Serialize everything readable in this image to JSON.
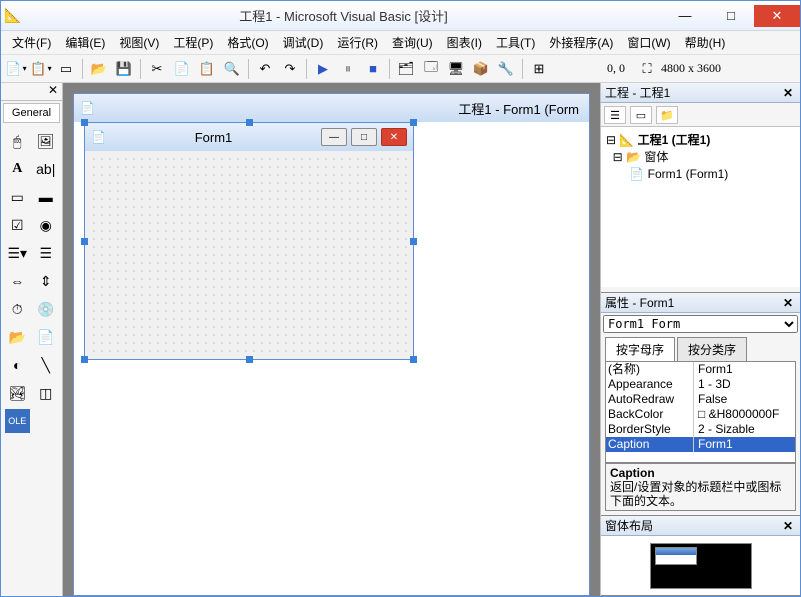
{
  "title": "工程1 - Microsoft Visual Basic [设计]",
  "menu": [
    "文件(F)",
    "编辑(E)",
    "视图(V)",
    "工程(P)",
    "格式(O)",
    "调试(D)",
    "运行(R)",
    "查询(U)",
    "图表(I)",
    "工具(T)",
    "外接程序(A)",
    "窗口(W)",
    "帮助(H)"
  ],
  "coords": "0, 0",
  "dims": "4800 x 3600",
  "toolbox_tab": "General",
  "mdi_title": "工程1 - Form1 (Form",
  "form_caption": "Form1",
  "explorer": {
    "title": "工程 - 工程1",
    "root": "工程1 (工程1)",
    "folder": "窗体",
    "item": "Form1 (Form1)"
  },
  "properties": {
    "title": "属性 - Form1",
    "selector": "Form1 Form",
    "tabs": [
      "按字母序",
      "按分类序"
    ],
    "rows": [
      {
        "name": "(名称)",
        "value": "Form1"
      },
      {
        "name": "Appearance",
        "value": "1 - 3D"
      },
      {
        "name": "AutoRedraw",
        "value": "False"
      },
      {
        "name": "BackColor",
        "value": "&H8000000F"
      },
      {
        "name": "BorderStyle",
        "value": "2 - Sizable"
      },
      {
        "name": "Caption",
        "value": "Form1",
        "selected": true
      }
    ],
    "desc_title": "Caption",
    "desc_body": "返回/设置对象的标题栏中或图标下面的文本。"
  },
  "layout_title": "窗体布局"
}
